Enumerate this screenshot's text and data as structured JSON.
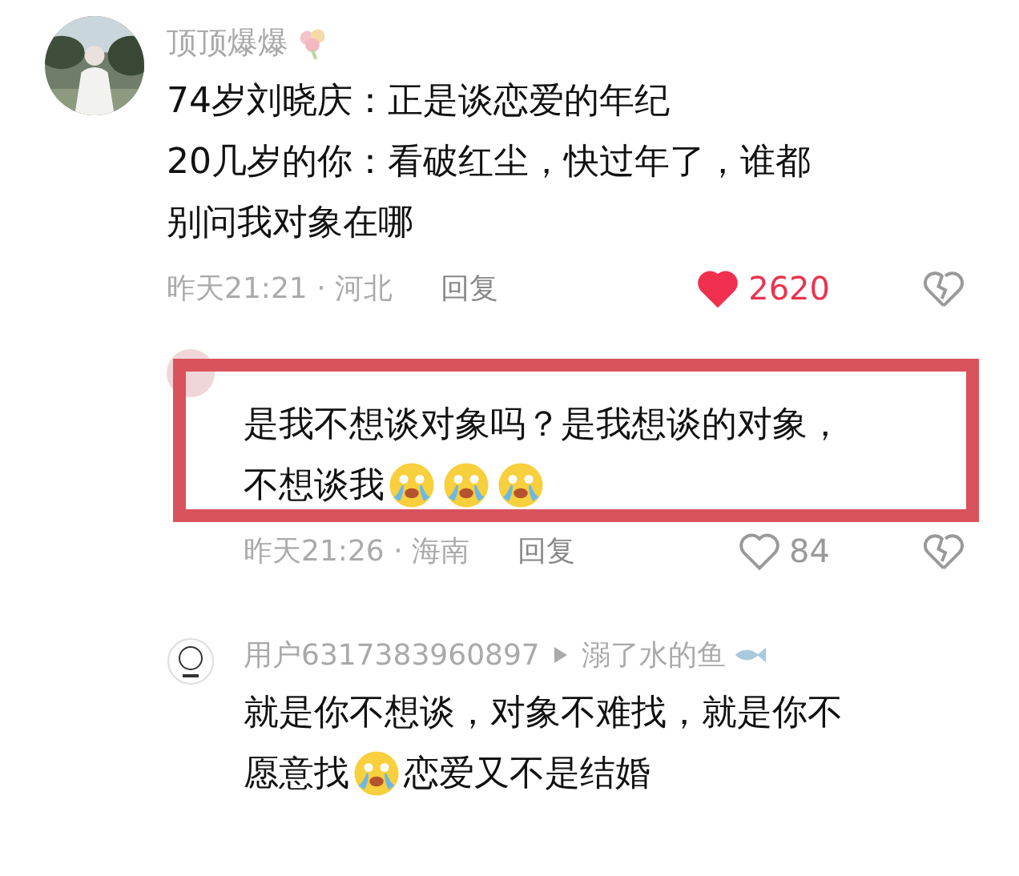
{
  "comment": {
    "user": "顶顶爆爆",
    "lines": [
      [
        {
          "kind": "text",
          "text": "74岁刘晓庆：正是谈恋爱的年纪"
        }
      ],
      [
        {
          "kind": "text",
          "text": "20几岁的你：看破红尘，快过年了，谁都"
        }
      ],
      [
        {
          "kind": "text",
          "text": "别问我对象在哪"
        }
      ]
    ],
    "meta": "昨天21:21 · 河北",
    "reply": "回复",
    "liked": true,
    "likes": "2620"
  },
  "replies": [
    {
      "highlighted": true,
      "lines": [
        [
          {
            "kind": "text",
            "text": "是我不想谈对象吗？是我想谈的对象，"
          }
        ],
        [
          {
            "kind": "text",
            "text": "不想谈我"
          },
          {
            "kind": "emoji"
          },
          {
            "kind": "emoji"
          },
          {
            "kind": "emoji"
          }
        ]
      ],
      "meta": "昨天21:26 · 海南",
      "reply": "回复",
      "liked": false,
      "likes": "84"
    },
    {
      "highlighted": false,
      "user": "用户6317383960897",
      "reply_to": "溺了水的鱼",
      "lines": [
        [
          {
            "kind": "text",
            "text": "就是你不想谈，对象不难找，就是你不"
          }
        ],
        [
          {
            "kind": "text",
            "text": "愿意找"
          },
          {
            "kind": "emoji"
          },
          {
            "kind": "text",
            "text": "恋爱又不是结婚"
          }
        ]
      ]
    }
  ]
}
